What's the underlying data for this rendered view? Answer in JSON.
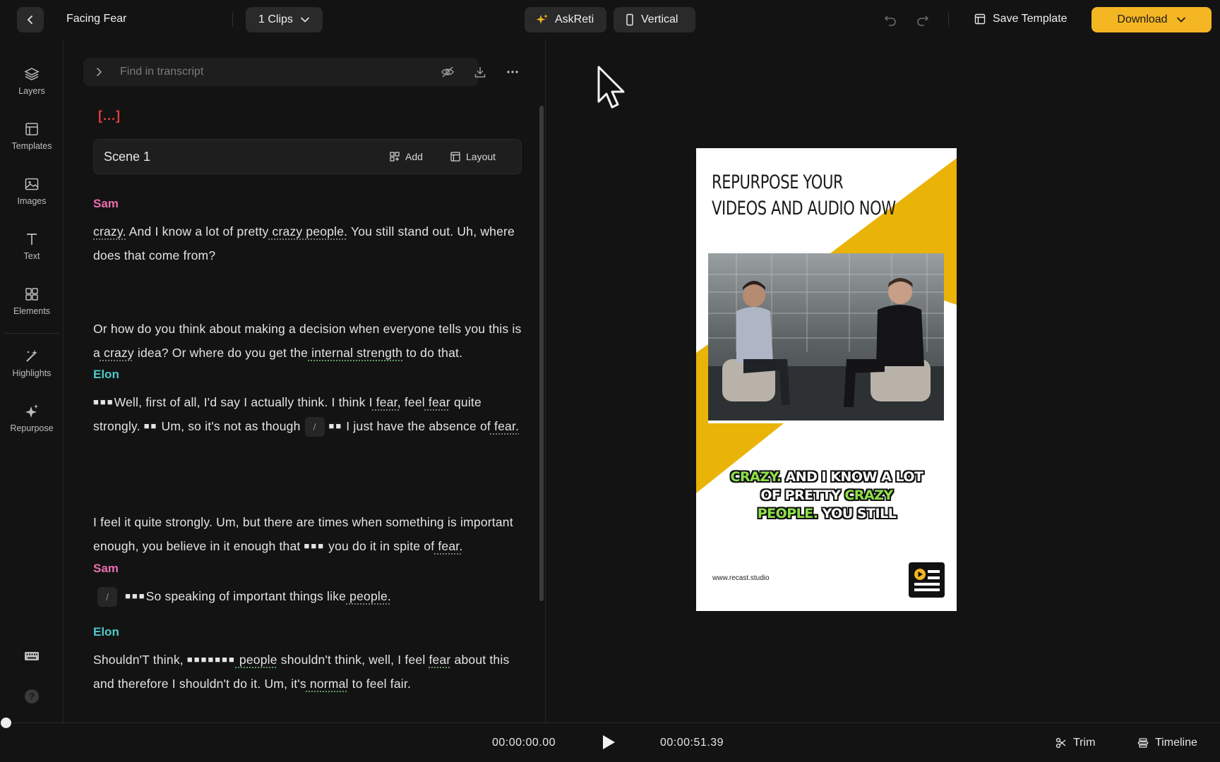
{
  "header": {
    "project_title": "Facing Fear",
    "clips_label": "1 Clips",
    "askreti_label": "AskReti",
    "vertical_label": "Vertical",
    "save_template_label": "Save Template",
    "download_label": "Download",
    "accent_color": "#f5b623"
  },
  "sidebar": {
    "items": [
      {
        "label": "Layers",
        "icon": "layers-icon"
      },
      {
        "label": "Templates",
        "icon": "templates-icon"
      },
      {
        "label": "Images",
        "icon": "image-icon"
      },
      {
        "label": "Text",
        "icon": "text-icon"
      },
      {
        "label": "Elements",
        "icon": "elements-icon"
      },
      {
        "label": "Highlights",
        "icon": "magic-wand-icon"
      },
      {
        "label": "Repurpose",
        "icon": "sparkle-icon"
      }
    ]
  },
  "transcript": {
    "search_placeholder": "Find in transcript",
    "bracket": "[...]",
    "scene_title": "Scene 1",
    "add_label": "Add",
    "layout_label": "Layout",
    "slash": "/",
    "blocks": [
      {
        "speaker": "Sam",
        "color": "#e86fb0"
      },
      {
        "speaker": "Elon",
        "color": "#4ec9c9"
      },
      {
        "speaker": "Sam",
        "color": "#e86fb0"
      },
      {
        "speaker": "Elon",
        "color": "#4ec9c9"
      }
    ],
    "p1": {
      "a": "crazy.",
      "b": " And I know a lot of pretty",
      "c": " crazy people.",
      "d": " You still stand out. Uh, where does that come from?"
    },
    "p2": {
      "a": "Or how do you think about making a decision when everyone tells you this is a",
      "b": " crazy",
      "c": " idea? Or where do you get the",
      "d": " internal strength",
      "e": " to do that."
    },
    "p3": {
      "a": "Well, first of all, I'd say I actually think. I think I",
      "b": " fear,",
      "c": " feel",
      "d": " fear",
      "e": " quite strongly.",
      "f": " Um, so it's not as though",
      "g": " I just have the absence of",
      "h": " fear."
    },
    "p4": {
      "a": "I feel it quite strongly. Um, but there are times when something is important enough, you believe in it enough that",
      "b": " you do it in spite of",
      "c": " fear."
    },
    "p5": {
      "a": "So speaking of important things like",
      "b": " people."
    },
    "p6": {
      "a": "Shouldn'T think,",
      "b": " people",
      "c": " shouldn't think, well, I feel",
      "d": "fear",
      "e": " about this and therefore I shouldn't do it. Um, it's",
      "f": " normal",
      "g": " to feel fair."
    }
  },
  "preview": {
    "headline": "REPURPOSE YOUR VIDEOS AND AUDIO NOW",
    "caption": {
      "w1": "CRAZY.",
      "w2": " AND I KNOW A LOT OF PRETTY ",
      "w3": "CRAZY",
      "w4": "PEOPLE.",
      "w5": " YOU STILL"
    },
    "url": "www.recast.studio",
    "highlight_color": "#8de04a",
    "shape_color": "#eab308"
  },
  "player": {
    "current_time": "00:00:00.00",
    "total_time": "00:00:51.39",
    "trim_label": "Trim",
    "timeline_label": "Timeline"
  }
}
